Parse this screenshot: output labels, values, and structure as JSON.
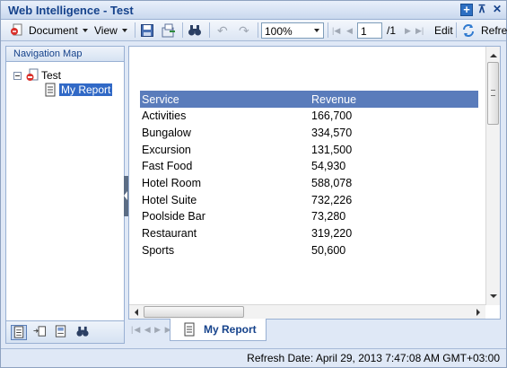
{
  "window": {
    "title": "Web Intelligence - Test"
  },
  "toolbar": {
    "document_label": "Document",
    "view_label": "View",
    "zoom_value": "100%",
    "page_current": "1",
    "page_total": "/1",
    "edit_label": "Edit",
    "refresh_label": "Refre"
  },
  "nav": {
    "header": "Navigation Map",
    "tree": {
      "root": "Test",
      "child": "My Report"
    }
  },
  "report": {
    "columns": [
      "Service",
      "Revenue"
    ],
    "rows": [
      [
        "Activities",
        "166,700"
      ],
      [
        "Bungalow",
        "334,570"
      ],
      [
        "Excursion",
        "131,500"
      ],
      [
        "Fast Food",
        "54,930"
      ],
      [
        "Hotel Room",
        "588,078"
      ],
      [
        "Hotel Suite",
        "732,226"
      ],
      [
        "Poolside Bar",
        "73,280"
      ],
      [
        "Restaurant",
        "319,220"
      ],
      [
        "Sports",
        "50,600"
      ]
    ]
  },
  "tabs": [
    {
      "label": "My Report"
    }
  ],
  "status": {
    "refresh_date": "Refresh Date: April 29, 2013 7:47:08 AM GMT+03:00"
  }
}
